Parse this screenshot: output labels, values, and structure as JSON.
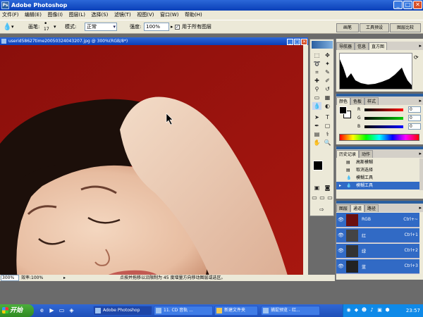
{
  "app": {
    "title": "Adobe Photoshop",
    "icon": "photoshop-icon"
  },
  "window_buttons": [
    "_",
    "□",
    "✕"
  ],
  "menu": [
    "文件(F)",
    "编辑(E)",
    "图像(I)",
    "图层(L)",
    "选择(S)",
    "滤镜(T)",
    "视图(V)",
    "窗口(W)",
    "帮助(H)"
  ],
  "options": {
    "brush_label": "画笔:",
    "brush_size": "17",
    "mode_label": "模式:",
    "mode_value": "正常",
    "strength_label": "强度:",
    "strength_value": "100%",
    "all_layers_label": "用于所有图层",
    "all_layers_checked": true
  },
  "panel_well": {
    "brushes": "画笔",
    "tool_presets": "工具预设",
    "layer_comps": "图层比较"
  },
  "document": {
    "title": "userid58627time20050324043207.jpg @ 300%(RGB/8*)",
    "zoom": "300%",
    "efficiency": "效率:100%",
    "status_hint": "点按并拖移以沿限制为 45 度增量方向移动图层或选区。"
  },
  "navigator": {
    "tabs": [
      "导航器",
      "信息",
      "直方图"
    ]
  },
  "color_panel": {
    "tabs": [
      "颜色",
      "色板",
      "样式"
    ],
    "sliders": [
      {
        "channel": "R",
        "value": "0",
        "color": "#cc0000"
      },
      {
        "channel": "G",
        "value": "0",
        "color": "#00aa00"
      },
      {
        "channel": "B",
        "value": "0",
        "color": "#0000cc"
      }
    ]
  },
  "history": {
    "tabs": [
      "历史记录",
      "动作"
    ],
    "items": [
      {
        "label": "高斯模糊",
        "selected": false
      },
      {
        "label": "取消选择",
        "selected": false
      },
      {
        "label": "模糊工具",
        "selected": false
      },
      {
        "label": "模糊工具",
        "selected": true
      }
    ]
  },
  "channels": {
    "tabs": [
      "图层",
      "通道",
      "路径"
    ],
    "items": [
      {
        "label": "RGB",
        "shortcut": "Ctrl+~"
      },
      {
        "label": "红",
        "shortcut": "Ctrl+1"
      },
      {
        "label": "绿",
        "shortcut": "Ctrl+2"
      },
      {
        "label": "蓝",
        "shortcut": "Ctrl+3"
      }
    ]
  },
  "taskbar": {
    "start": "开始",
    "tasks": [
      {
        "label": "Adobe Photoshop",
        "active": true
      },
      {
        "label": "11. CD 音轨 ...",
        "active": false
      },
      {
        "label": "新建文件夹",
        "active": false
      },
      {
        "label": "捕捉预览 - 红...",
        "active": false
      }
    ],
    "clock": "23:57"
  }
}
